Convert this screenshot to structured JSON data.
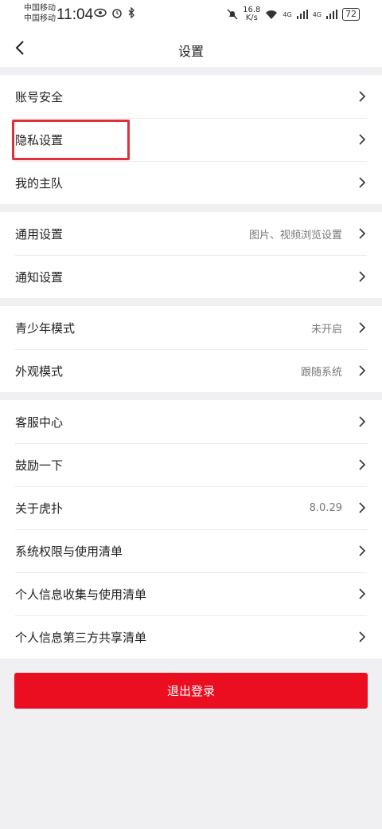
{
  "status_bar": {
    "carrier_1": "中国移动",
    "carrier_2": "中国移动",
    "time": "11:04",
    "speed_value": "16.8",
    "speed_unit": "K/s",
    "network_1": "4G",
    "network_2": "4G",
    "battery": "72"
  },
  "nav": {
    "title": "设置"
  },
  "groups": [
    {
      "items": [
        {
          "label": "账号安全",
          "value": ""
        },
        {
          "label": "隐私设置",
          "value": ""
        },
        {
          "label": "我的主队",
          "value": ""
        }
      ]
    },
    {
      "items": [
        {
          "label": "通用设置",
          "value": "图片、视频浏览设置"
        },
        {
          "label": "通知设置",
          "value": ""
        }
      ]
    },
    {
      "items": [
        {
          "label": "青少年模式",
          "value": "未开启"
        },
        {
          "label": "外观模式",
          "value": "跟随系统"
        }
      ]
    },
    {
      "items": [
        {
          "label": "客服中心",
          "value": ""
        },
        {
          "label": "鼓励一下",
          "value": ""
        },
        {
          "label": "关于虎扑",
          "value": "8.0.29"
        },
        {
          "label": "系统权限与使用清单",
          "value": ""
        },
        {
          "label": "个人信息收集与使用清单",
          "value": ""
        },
        {
          "label": "个人信息第三方共享清单",
          "value": ""
        }
      ]
    }
  ],
  "logout_label": "退出登录",
  "colors": {
    "accent": "#ea0e20",
    "highlight": "#e0303b"
  }
}
